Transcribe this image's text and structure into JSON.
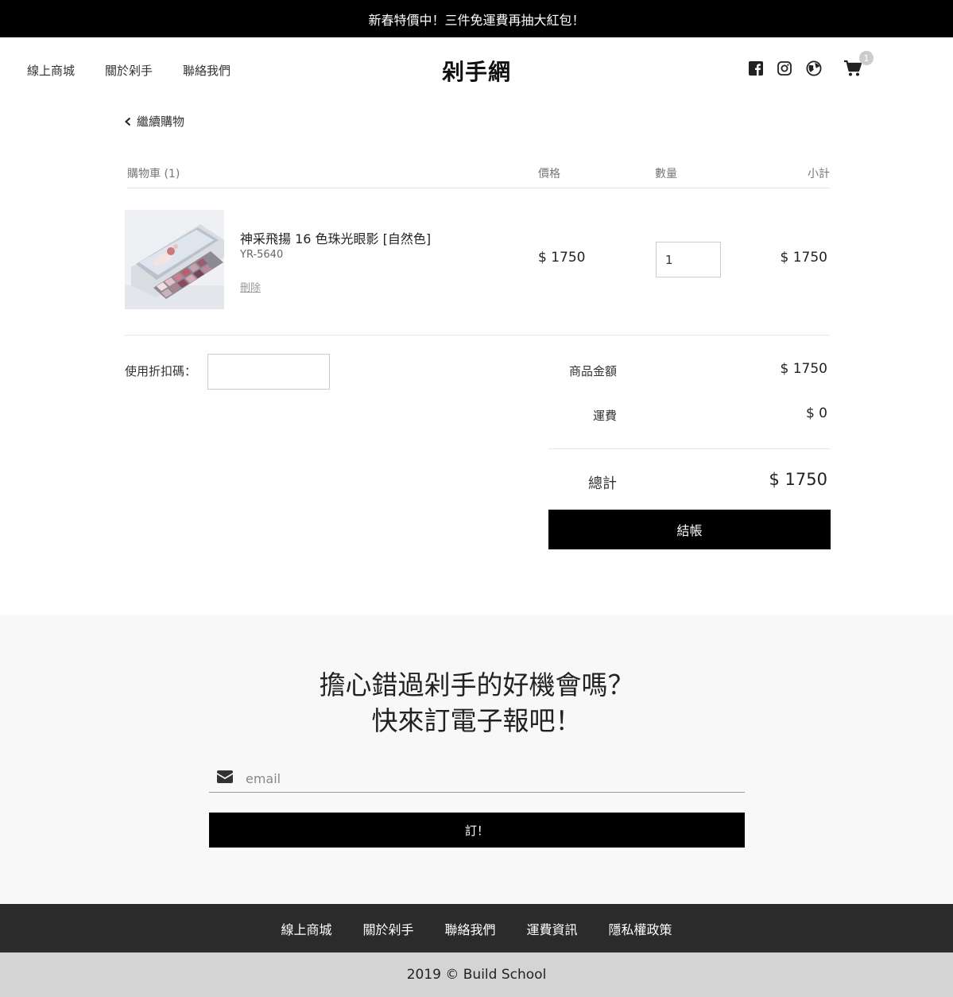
{
  "promo": {
    "text": "新春特價中！三件免運費再抽大紅包！"
  },
  "header": {
    "logo": "剁手網",
    "nav": [
      "線上商城",
      "關於剁手",
      "聯絡我們"
    ],
    "icons": [
      "facebook-icon",
      "instagram-icon",
      "globe-icon",
      "cart-icon"
    ],
    "cart_count": "1"
  },
  "back": {
    "label": "繼續購物"
  },
  "cart": {
    "headers": {
      "cart": "購物車 (1)",
      "price": "價格",
      "qty": "數量",
      "subtotal": "小計"
    },
    "items": [
      {
        "name": "神采飛揚 16 色珠光眼影 [自然色]",
        "sku": "YR-5640",
        "delete": "刪除",
        "price": "$ 1750",
        "qty": "1",
        "subtotal": "$ 1750"
      }
    ]
  },
  "coupon": {
    "label": "使用折扣碼：",
    "value": ""
  },
  "summary": {
    "goods_label": "商品金額",
    "goods_value": "$ 1750",
    "shipping_label": "運費",
    "shipping_value": "$ 0",
    "total_label": "總計",
    "total_value": "$ 1750",
    "checkout": "結帳"
  },
  "newsletter": {
    "title_line1": "擔心錯過剁手的好機會嗎？",
    "title_line2": "快來訂電子報吧！",
    "placeholder": "email",
    "button": "訂！"
  },
  "footer": {
    "links": [
      "線上商城",
      "關於剁手",
      "聯絡我們",
      "運費資訊",
      "隱私權政策"
    ],
    "copyright": "2019 © Build School"
  },
  "colors": {
    "primary": "#000000",
    "footer_dark": "#2b2b2b",
    "footer_light": "#d4d4d4",
    "newsletter_bg": "#f8f8f8"
  }
}
